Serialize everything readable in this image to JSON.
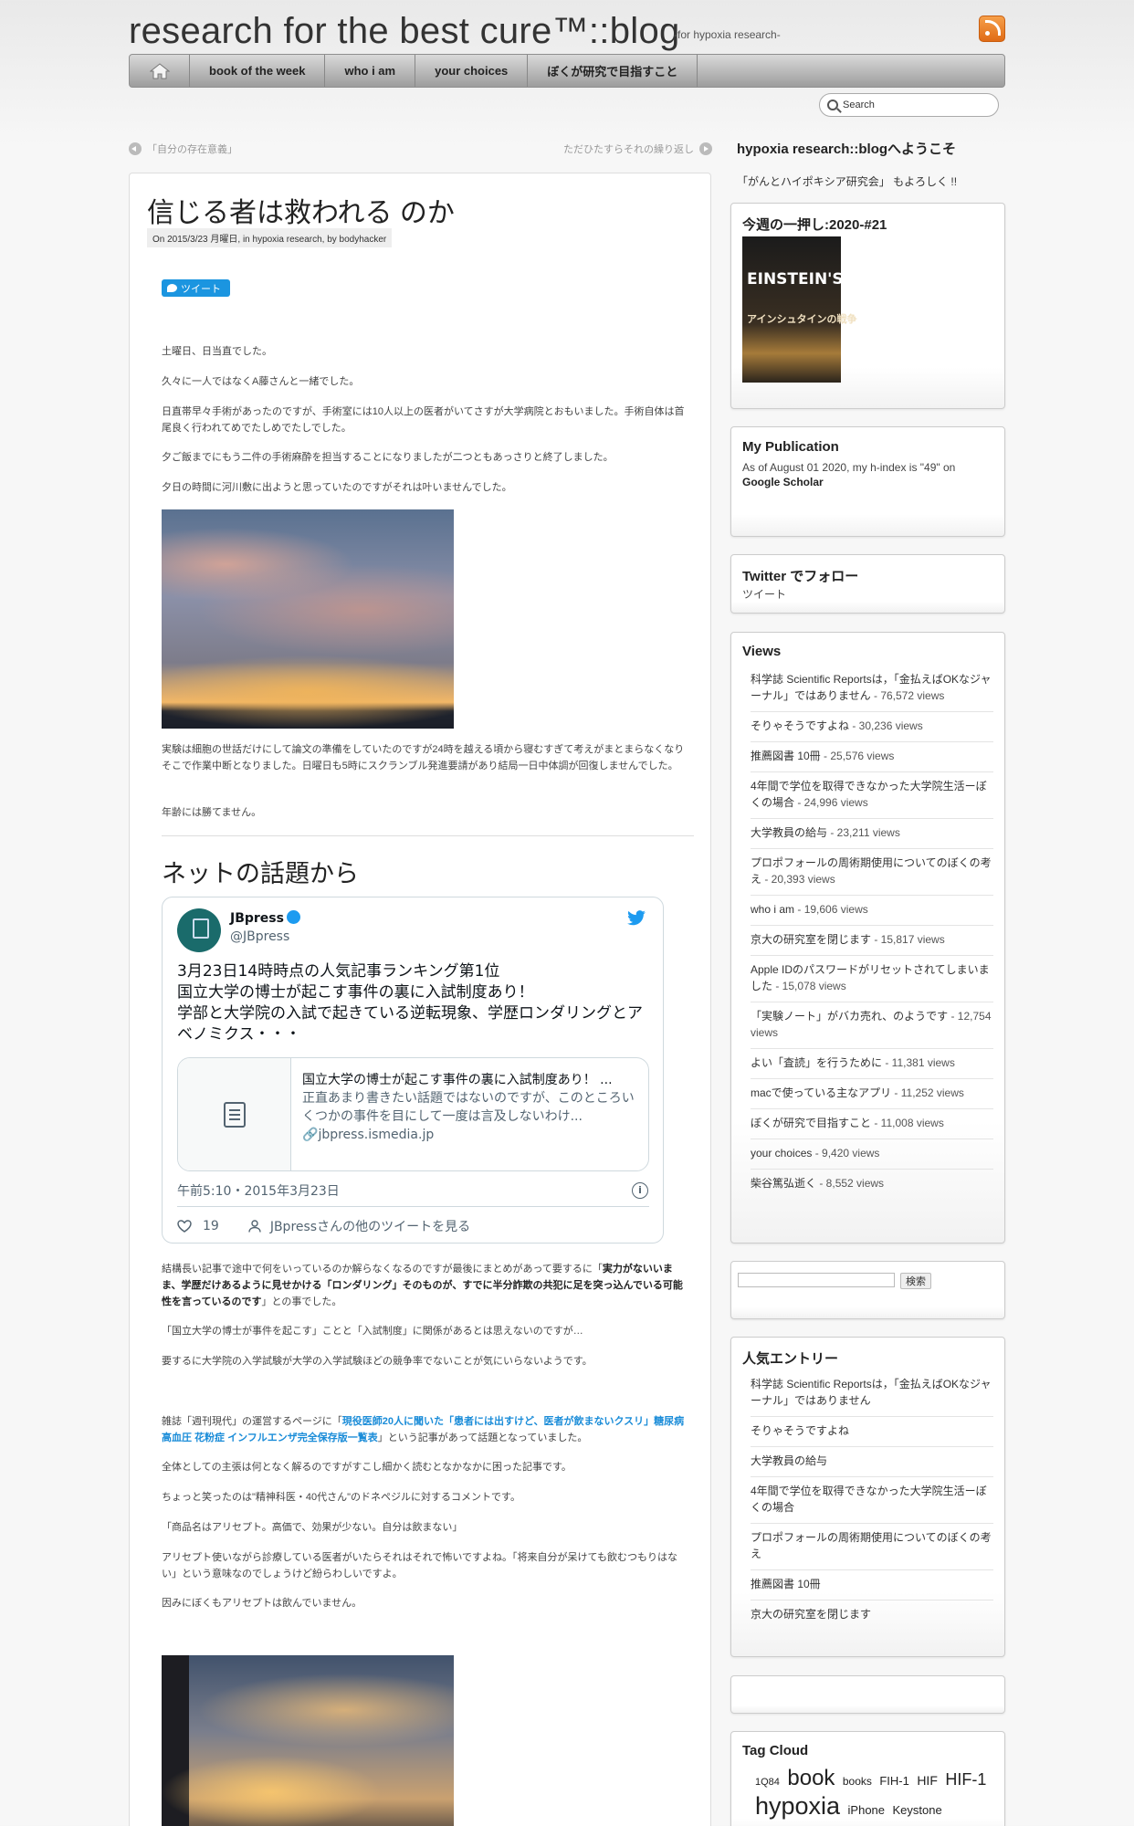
{
  "header": {
    "title": "research for the best cure™::blog",
    "description": "-for hypoxia research-"
  },
  "nav": {
    "items": [
      "book of the week",
      "who i am",
      "your choices",
      "ぼくが研究で目指すこと"
    ]
  },
  "search": {
    "placeholder": "Search"
  },
  "postnav": {
    "prev": "「自分の存在意義」",
    "next": "ただひたすらそれの繰り返し"
  },
  "post": {
    "title": "信じる者は救われる のか",
    "meta": "On 2015/3/23 月曜日, in hypoxia research, by bodyhacker",
    "tweet_button": "ツイート",
    "paragraphs": [
      "土曜日、日当直でした。",
      "久々に一人ではなくA藤さんと一緒でした。",
      "日直帯早々手術があったのですが、手術室には10人以上の医者がいてさすが大学病院とおもいました。手術自体は首尾良く行われてめでたしめでたしでした。",
      "夕ご飯までにもう二件の手術麻酔を担当することになりましたが二つともあっさりと終了しました。",
      "夕日の時間に河川敷に出ようと思っていたのですがそれは叶いませんでした。",
      "実験は細胞の世話だけにして論文の準備をしていたのですが24時を越える頃から寝むすぎて考えがまとまらなくなりそこで作業中断となりました。日曜日も5時にスクランブル発進要請があり結局一日中体調が回復しませんでした。",
      "年齢には勝てません。"
    ],
    "section_heading": "ネットの話題から",
    "para_after_1_pre": "結構長い記事で途中で何をいっているのか解らなくなるのですが最後にまとめがあって要するに「",
    "para_after_1_bold": "実力がないいまま、学歴だけあるように見せかける「ロンダリング」そのものが、すでに半分詐欺の共犯に足を突っ込んでいる可能性を言っているのです",
    "para_after_1_post": "」との事でした。",
    "para_after_2": "「国立大学の博士が事件を起こす」ことと「入試制度」に関係があるとは思えないのですが…",
    "para_after_3": "要するに大学院の入学試験が大学の入学試験ほどの競争率でないことが気にいらないようです。",
    "para_after_4_pre": "雑誌「週刊現代」の運営するページに「",
    "para_after_4_link": "現役医師20人に聞いた「患者には出すけど、医者が飲まないクスリ」糖尿病 高血圧 花粉症 インフルエンザ完全保存版一覧表",
    "para_after_4_post": "」という記事があって話題となっていました。",
    "para_after_5": "全体としての主張は何となく解るのですがすこし細かく読むとなかなかに困った記事です。",
    "para_after_6": "ちょっと笑ったのは\"精神科医・40代さん\"のドネペジルに対するコメントです。",
    "para_after_7": "「商品名はアリセプト。高価で、効果が少ない。自分は飲まない」",
    "para_after_8": "アリセプト使いながら診療している医者がいたらそれはそれで怖いですよね。「将来自分が呆けても飲むつもりはない」という意味なのでしょうけど紛らわしいですよ。",
    "para_after_9": "因みにぼくもアリセプトは飲んでいません。"
  },
  "embedded_tweet": {
    "name": "JBpress",
    "handle": "@JBpress",
    "text_line1": "3月23日14時時点の人気記事ランキング第1位",
    "text_line2": "国立大学の博士が起こす事件の裏に入試制度あり！",
    "text_line3": "学部と大学院の入試で起きている逆転現象、学歴ロンダリングとアベノミクス・・・",
    "card_title": "国立大学の博士が起こす事件の裏に入試制度あり！ ...",
    "card_desc": "正直あまり書きたい話題ではないのですが、このところいくつかの事件を目にして一度は言及しないわけ...",
    "card_domain": "jbpress.ismedia.jp",
    "time": "午前5:10・2015年3月23日",
    "likes": "19",
    "more": "JBpressさんの他のツイートを見る"
  },
  "sidebar": {
    "welcome_title": "hypoxia research::blogへようこそ",
    "welcome_text": "「がんとハイポキシア研究会」 もよろしく !!",
    "book_widget": {
      "title": "今週の一押し:2020-#21",
      "book_title_en": "EINSTEIN'S WAR",
      "book_title_ja": "アインシュタインの戦争"
    },
    "publication": {
      "title": "My Publication",
      "text": "As of August 01 2020, my h-index is \"49\" on",
      "link": "Google Scholar"
    },
    "twitter": {
      "title": "Twitter でフォロー",
      "text": "ツイート"
    },
    "views": {
      "title": "Views",
      "items": [
        {
          "label": "科学誌 Scientific Reportsは，「金払えばOKなジャーナル」ではありません",
          "count": " - 76,572 views"
        },
        {
          "label": "そりゃそうですよね",
          "count": " - 30,236 views"
        },
        {
          "label": "推薦図書 10冊",
          "count": " - 25,576 views"
        },
        {
          "label": "4年間で学位を取得できなかった大学院生活ーぼくの場合",
          "count": " - 24,996 views"
        },
        {
          "label": "大学教員の給与",
          "count": " - 23,211 views"
        },
        {
          "label": "プロポフォールの周術期使用についてのぼくの考え",
          "count": " - 20,393 views"
        },
        {
          "label": "who i am",
          "count": " - 19,606 views"
        },
        {
          "label": "京大の研究室を閉じます",
          "count": " - 15,817 views"
        },
        {
          "label": "Apple IDのパスワードがリセットされてしまいました",
          "count": " - 15,078 views"
        },
        {
          "label": "「実験ノート」がバカ売れ、のようです",
          "count": " - 12,754 views"
        },
        {
          "label": "よい「査読」を行うために",
          "count": " - 11,381 views"
        },
        {
          "label": "macで使っている主なアプリ",
          "count": " - 11,252 views"
        },
        {
          "label": "ぼくが研究で目指すこと",
          "count": " - 11,008 views"
        },
        {
          "label": "your choices",
          "count": " - 9,420 views"
        },
        {
          "label": "柴谷篤弘逝く",
          "count": " - 8,552 views"
        }
      ]
    },
    "search_button": "検索",
    "popular": {
      "title": "人気エントリー",
      "items": [
        "科学誌 Scientific Reportsは，「金払えばOKなジャーナル」ではありません",
        "そりゃそうですよね",
        "大学教員の給与",
        "4年間で学位を取得できなかった大学院生活ーぼくの場合",
        "プロポフォールの周術期使用についてのぼくの考え",
        "推薦図書 10冊",
        "京大の研究室を閉じます"
      ]
    },
    "tag_cloud": {
      "title": "Tag Cloud",
      "tags": [
        "1Q84",
        "book",
        "books",
        "FIH-1",
        "HIF",
        "HIF-1",
        "hypoxia",
        "iPhone",
        "Keystone"
      ]
    }
  }
}
